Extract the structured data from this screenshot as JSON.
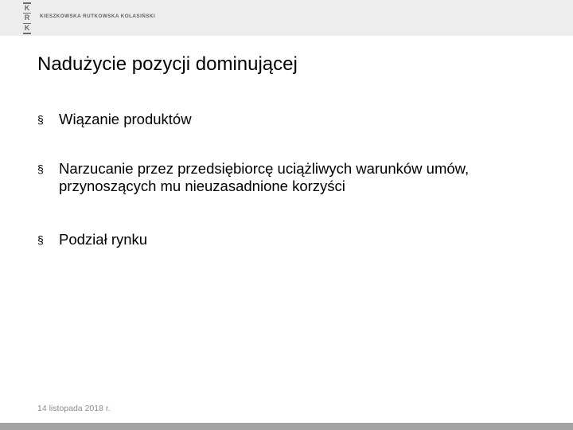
{
  "header": {
    "logo_letters": [
      "K",
      "R",
      "K"
    ],
    "firm_name": "KIESZKOWSKA RUTKOWSKA KOLASIŃSKI"
  },
  "slide": {
    "title": "Nadużycie pozycji dominującej",
    "bullet_marker": "§",
    "bullets": [
      {
        "text": "Wiązanie produktów"
      },
      {
        "text": "Narzucanie przez przedsiębiorcę uciążliwych warunków umów, przynoszących mu nieuzasadnione korzyści"
      },
      {
        "text": "Podział rynku"
      }
    ]
  },
  "footer": {
    "date": "14 listopada 2018 r."
  },
  "colors": {
    "header_band": "#ededed",
    "bottom_band": "#a3a3a3",
    "logo_gray": "#6b6b6b"
  }
}
